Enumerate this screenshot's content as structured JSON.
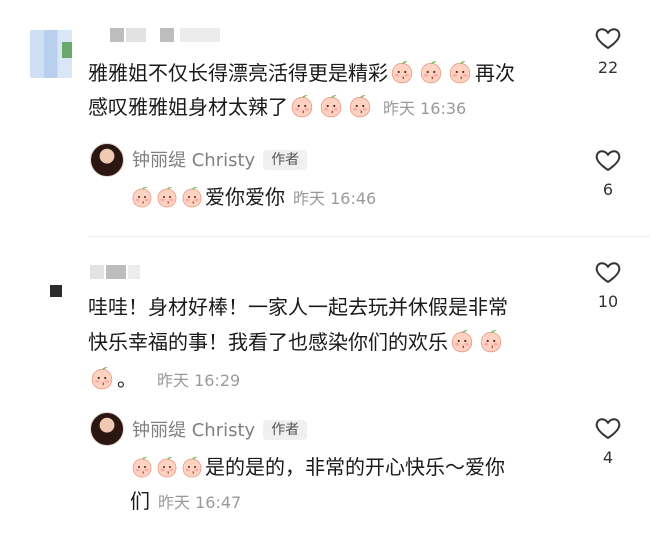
{
  "comment1": {
    "text_line1": "雅雅姐不仅长得漂亮活得更是精彩",
    "text_line1_after": "再次",
    "text_line2": "感叹雅雅姐身材太辣了",
    "time": "昨天 16:36",
    "likes": "22",
    "emojis_line1": [
      "peach-kiss",
      "peach-kiss",
      "peach-kiss"
    ],
    "emojis_line2": [
      "peach-heart-eyes",
      "peach-heart-eyes",
      "peach-heart-eyes"
    ]
  },
  "reply1": {
    "author": "钟丽缇 Christy",
    "badge": "作者",
    "text": "爱你爱你",
    "time": "昨天 16:46",
    "likes": "6",
    "emojis": [
      "peach-blush-kiss",
      "peach-blush-kiss",
      "peach-blush-kiss"
    ]
  },
  "comment2": {
    "text_line1": "哇哇！身材好棒！一家人一起去玩并休假是非常",
    "text_line2": "快乐幸福的事！我看了也感染你们的欢乐",
    "text_line3_suffix": "。",
    "time": "昨天 16:29",
    "likes": "10",
    "emojis_line2": [
      "peach-blush-kiss",
      "peach-blush-kiss"
    ],
    "emojis_line3": [
      "peach-blush-kiss"
    ]
  },
  "reply2": {
    "author": "钟丽缇 Christy",
    "badge": "作者",
    "text_line1": "是的是的，非常的开心快乐～爱你",
    "text_line2": "们",
    "time": "昨天 16:47",
    "likes": "4",
    "emojis": [
      "peach-blush-kiss",
      "peach-blush-kiss",
      "peach-blush-kiss"
    ]
  }
}
